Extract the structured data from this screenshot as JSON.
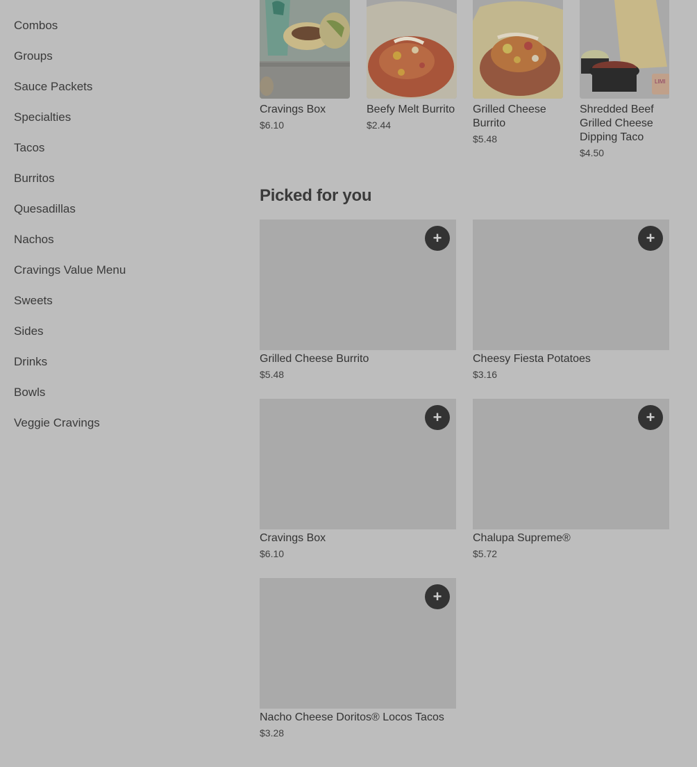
{
  "sidebar": {
    "items": [
      {
        "label": "Combos"
      },
      {
        "label": "Groups"
      },
      {
        "label": "Sauce Packets"
      },
      {
        "label": "Specialties"
      },
      {
        "label": "Tacos"
      },
      {
        "label": "Burritos"
      },
      {
        "label": "Quesadillas"
      },
      {
        "label": "Nachos"
      },
      {
        "label": "Cravings Value Menu"
      },
      {
        "label": "Sweets"
      },
      {
        "label": "Sides"
      },
      {
        "label": "Drinks"
      },
      {
        "label": "Bowls"
      },
      {
        "label": "Veggie Cravings"
      }
    ]
  },
  "carousel": {
    "items": [
      {
        "name": "Cravings Box",
        "price": "$6.10"
      },
      {
        "name": "Beefy Melt Burrito",
        "price": "$2.44"
      },
      {
        "name": "Grilled Cheese Burrito",
        "price": "$5.48"
      },
      {
        "name": "Shredded Beef Grilled Cheese Dipping Taco",
        "price": "$4.50"
      }
    ]
  },
  "picked": {
    "title": "Picked for you",
    "add_icon": "+",
    "items": [
      {
        "name": "Grilled Cheese Burrito",
        "price": "$5.48"
      },
      {
        "name": "Cheesy Fiesta Potatoes",
        "price": "$3.16"
      },
      {
        "name": "Cravings Box",
        "price": "$6.10"
      },
      {
        "name": "Chalupa Supreme®",
        "price": "$5.72"
      },
      {
        "name": "Nacho Cheese Doritos® Locos Tacos",
        "price": "$3.28"
      }
    ]
  }
}
